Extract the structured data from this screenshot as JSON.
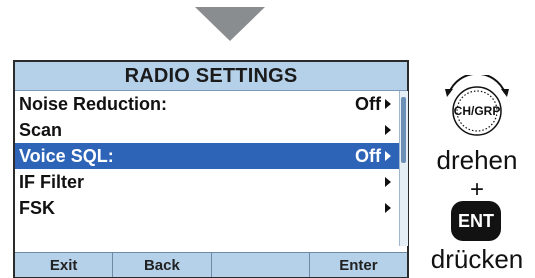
{
  "screen": {
    "title": "RADIO SETTINGS",
    "items": [
      {
        "label": "Noise Reduction:",
        "value": "Off",
        "has_arrow": true,
        "selected": false
      },
      {
        "label": "Scan",
        "value": "",
        "has_arrow": true,
        "selected": false
      },
      {
        "label": "Voice SQL:",
        "value": "Off",
        "has_arrow": true,
        "selected": true
      },
      {
        "label": "IF Filter",
        "value": "",
        "has_arrow": true,
        "selected": false
      },
      {
        "label": "FSK",
        "value": "",
        "has_arrow": true,
        "selected": false
      }
    ],
    "softkeys": [
      "Exit",
      "Back",
      "",
      "Enter"
    ]
  },
  "instructions": {
    "knob_label": "CH/GRP",
    "turn_text": "drehen",
    "plus": "+",
    "ent_label": "ENT",
    "press_text": "drücken"
  },
  "colors": {
    "header_bg": "#b5d1ea",
    "selection_bg": "#2e64b7"
  }
}
